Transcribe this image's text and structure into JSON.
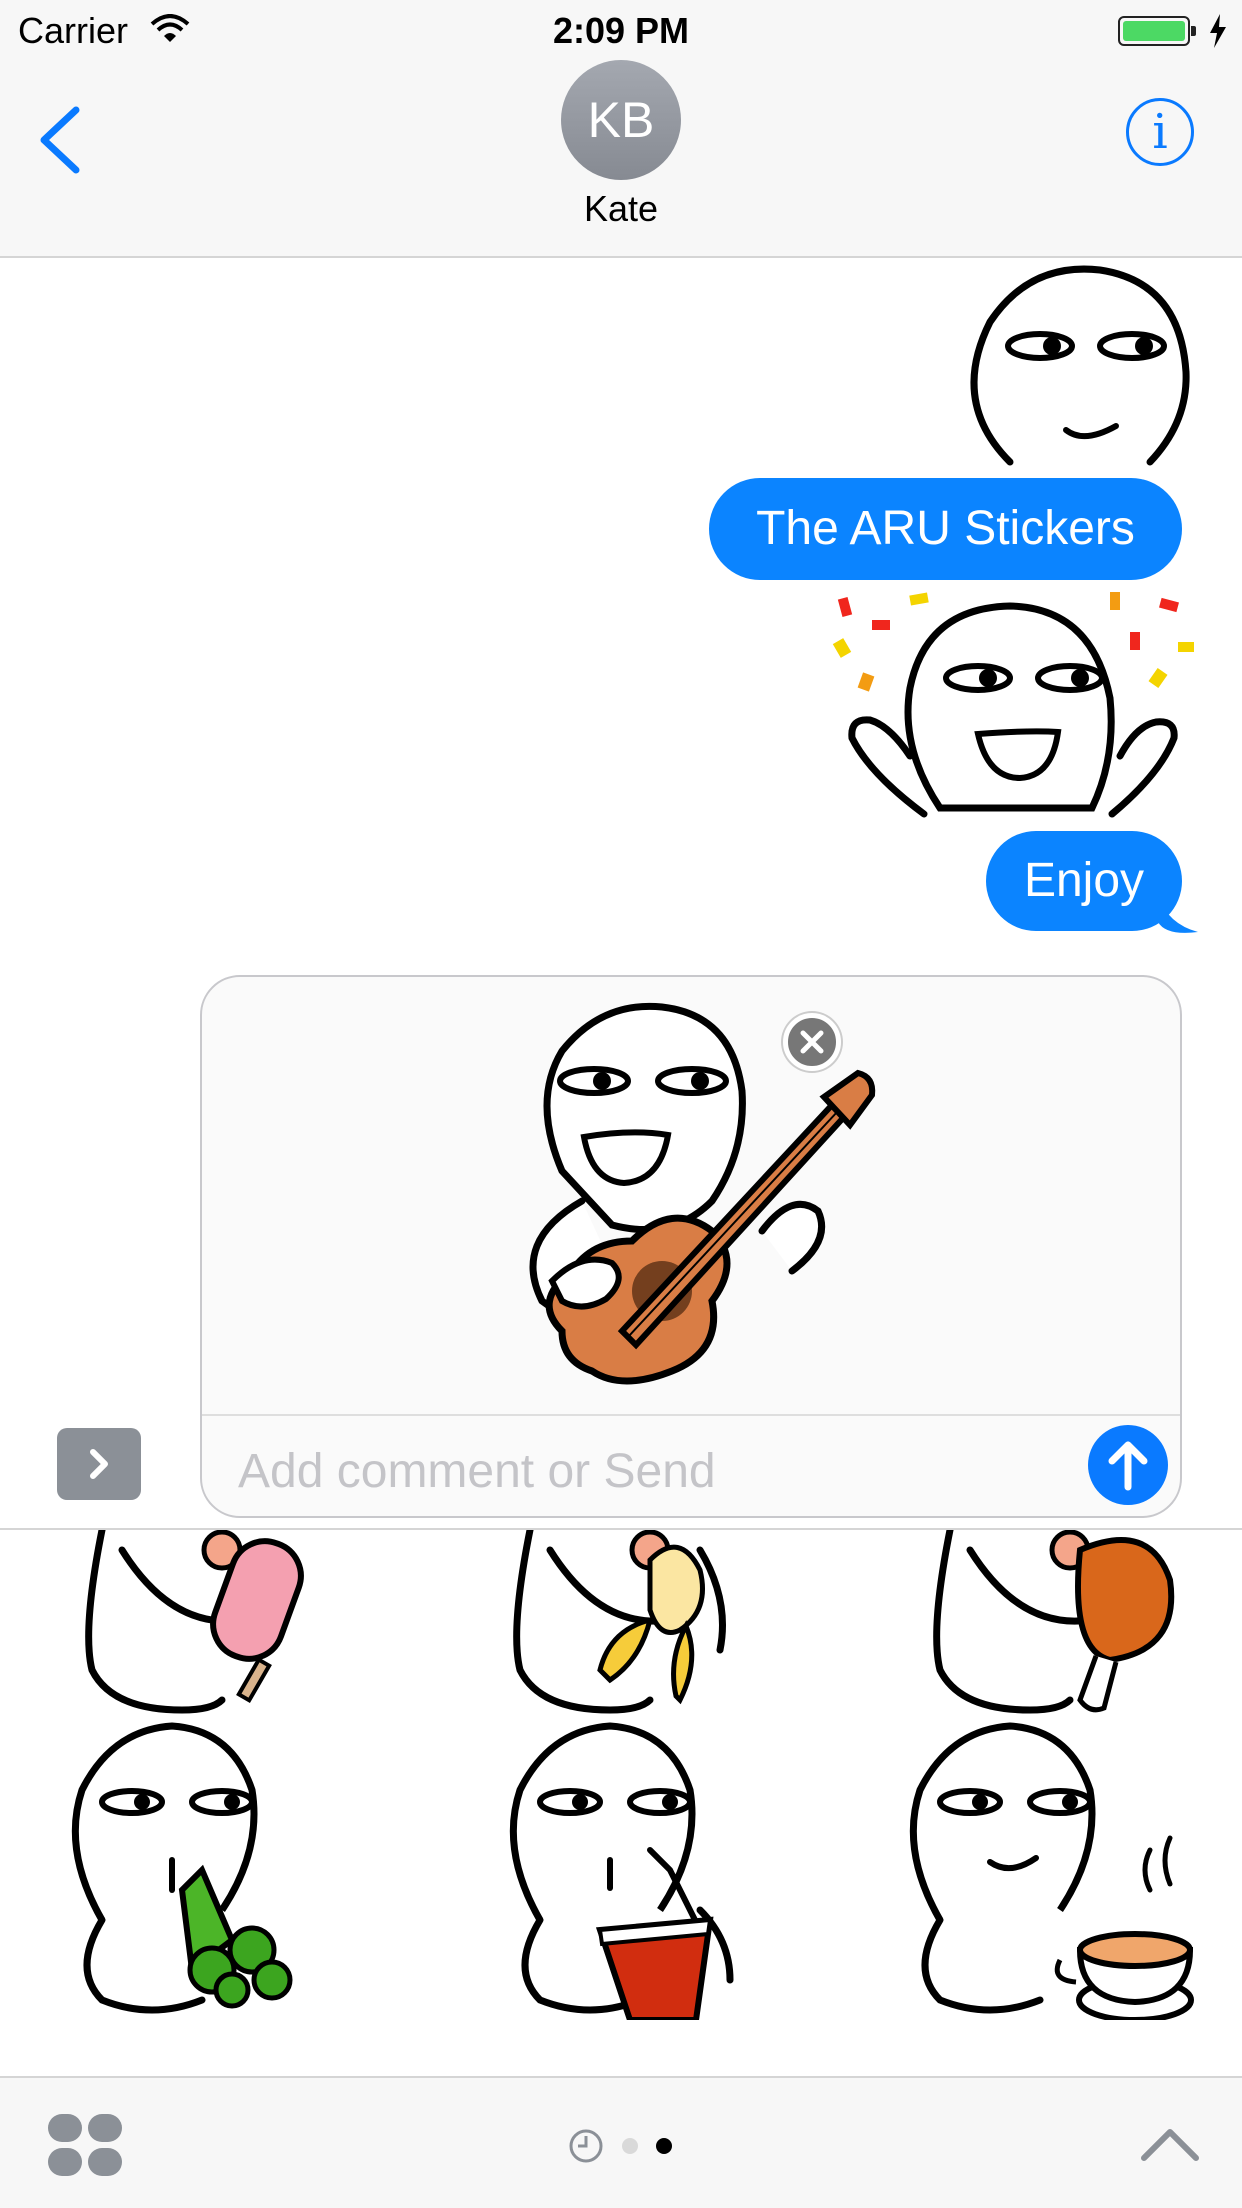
{
  "status_bar": {
    "carrier": "Carrier",
    "time": "2:09 PM"
  },
  "header": {
    "avatar_initials": "KB",
    "contact_name": "Kate"
  },
  "messages": [
    {
      "type": "sticker",
      "sticker": "aru-smirk"
    },
    {
      "type": "text",
      "text": "The ARU Stickers"
    },
    {
      "type": "sticker",
      "sticker": "aru-celebrate"
    },
    {
      "type": "text",
      "text": "Enjoy"
    }
  ],
  "compose": {
    "placeholder": "Add comment or Send",
    "staged_sticker": "aru-guitar"
  },
  "drawer": {
    "stickers": [
      "aru-popsicle",
      "aru-banana",
      "aru-chicken-leg",
      "aru-vegetables",
      "aru-soda",
      "aru-tea"
    ]
  },
  "toolbar": {
    "page_indicators": [
      "recents",
      "page-1",
      "page-2"
    ],
    "active_page": 2
  },
  "colors": {
    "accent": "#0a7aff",
    "bubble": "#0b84ff",
    "battery": "#4cd964"
  }
}
